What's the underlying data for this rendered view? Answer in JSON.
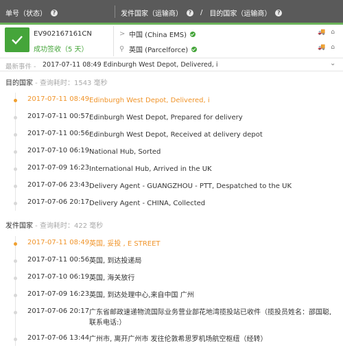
{
  "header": {
    "col1_label": "单号（状态）",
    "col2_label_a": "发件国家（运输商）",
    "separator": "/",
    "col2_label_b": "目的国家（运输商）"
  },
  "shipment": {
    "tracking_number": "EV902167161CN",
    "status": "成功签收（5 天）",
    "origin": "中国 (China EMS)",
    "destination": "英国 (Parcelforce)"
  },
  "latest": {
    "label": "最新事件 -",
    "text": "2017-07-11 08:49 Edinburgh West Depot, Delivered, i"
  },
  "dest_section": {
    "title": "目的国家",
    "meta": " - 查询耗时：1543 毫秒",
    "events": [
      {
        "time": "2017-07-11 08:49",
        "desc": "Edinburgh West Depot, Delivered, i"
      },
      {
        "time": "2017-07-11 00:57",
        "desc": "Edinburgh West Depot, Prepared for delivery"
      },
      {
        "time": "2017-07-11 00:56",
        "desc": "Edinburgh West Depot, Received at delivery depot"
      },
      {
        "time": "2017-07-10 06:19",
        "desc": "National Hub, Sorted"
      },
      {
        "time": "2017-07-09 16:23",
        "desc": "International Hub, Arrived in the UK"
      },
      {
        "time": "2017-07-06 23:43",
        "desc": "Delivery Agent - GUANGZHOU - PTT, Despatched to the UK"
      },
      {
        "time": "2017-07-06 20:17",
        "desc": "Delivery Agent - CHINA, Collected"
      }
    ]
  },
  "origin_section": {
    "title": "发件国家",
    "meta": " - 查询耗时：422 毫秒",
    "events": [
      {
        "time": "2017-07-11 08:49",
        "desc": "英国, 妥投 , E STREET"
      },
      {
        "time": "2017-07-11 00:56",
        "desc": "英国, 到达投递局"
      },
      {
        "time": "2017-07-10 06:19",
        "desc": "英国, 海关放行"
      },
      {
        "time": "2017-07-09 16:23",
        "desc": "英国, 到达处理中心,来自中国 广州"
      },
      {
        "time": "2017-07-06 20:17",
        "desc": "广东省邮政速递物流国际业务营业部花地湾揽投站已收件（揽投员姓名：邵国聪,联系电话:）"
      },
      {
        "time": "2017-07-06 13:44",
        "desc": "广州市, 离开广州市 发往伦敦希思罗机场航空枢纽（经转）"
      }
    ]
  },
  "colors": {
    "accent": "#45a53a",
    "active": "#f0942a",
    "header_bg": "#5a5a5a"
  }
}
